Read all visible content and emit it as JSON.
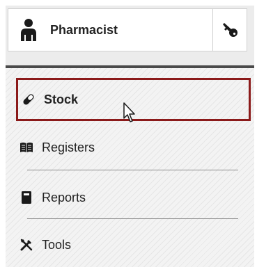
{
  "user": {
    "name": "Pharmacist",
    "icon": "user-icon",
    "key_icon": "key-icon"
  },
  "menu": {
    "items": [
      {
        "label": "Stock",
        "icon": "pill-icon",
        "active": true
      },
      {
        "label": "Registers",
        "icon": "open-book-icon",
        "active": false
      },
      {
        "label": "Reports",
        "icon": "book-icon",
        "active": false
      },
      {
        "label": "Tools",
        "icon": "tools-icon",
        "active": false
      }
    ]
  },
  "colors": {
    "active_border": "#8b1a1a",
    "text": "#222222",
    "top_divider": "#4a4a4a"
  }
}
